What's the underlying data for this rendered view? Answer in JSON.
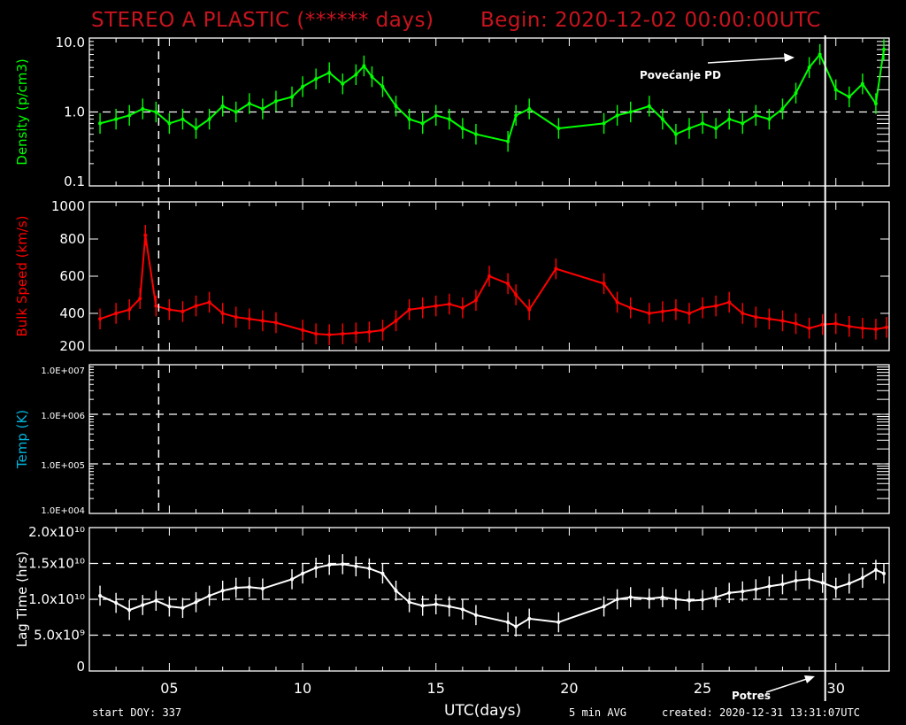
{
  "header": {
    "title": "STEREO A PLASTIC (****** days)",
    "begin": "Begin: 2020-12-02 00:00:00UTC"
  },
  "footer": {
    "start_doy": "start DOY: 337",
    "x_label": "UTC(days)",
    "avg": "5 min AVG",
    "created": "created: 2020-12-31 13:31:07UTC"
  },
  "annotations": {
    "density_increase": "Povećanje PD",
    "earthquake": "Potres"
  },
  "colors": {
    "background": "#000000",
    "title": "#c8141e",
    "density": "#00ff00",
    "speed": "#ff0000",
    "temp_label": "#00b4dc",
    "lag": "#ffffff",
    "axes": "#ffffff"
  },
  "chart_data": [
    {
      "type": "line",
      "name": "density-panel",
      "ylabel": "Density (p/cm3)",
      "yscale": "log",
      "ylim": [
        0.1,
        10.0
      ],
      "y_tick_labels": [
        "10.0",
        "1.0",
        "0.1"
      ],
      "reference_lines": [
        1.0
      ],
      "xlim": [
        2,
        32
      ],
      "x_tick_labels": [
        "05",
        "10",
        "15",
        "20",
        "25",
        "30"
      ],
      "x": [
        2.4,
        3.0,
        3.5,
        4.0,
        4.5,
        5.0,
        5.5,
        6.0,
        6.5,
        7.0,
        7.5,
        8.0,
        8.5,
        9.0,
        9.6,
        10.0,
        10.5,
        11.0,
        11.5,
        12.0,
        12.3,
        12.6,
        13.0,
        13.5,
        14.0,
        14.5,
        15.0,
        15.5,
        16.0,
        16.5,
        17.7,
        18.0,
        18.5,
        19.6,
        21.3,
        21.8,
        22.3,
        23.0,
        23.5,
        24.0,
        24.5,
        25.0,
        25.5,
        26.0,
        26.5,
        27.0,
        27.5,
        28.0,
        28.5,
        29.0,
        29.4,
        30.0,
        30.5,
        31.0,
        31.5,
        31.8
      ],
      "y": [
        0.7,
        0.8,
        0.9,
        1.1,
        1.0,
        0.7,
        0.8,
        0.6,
        0.8,
        1.2,
        1.0,
        1.3,
        1.1,
        1.4,
        1.6,
        2.2,
        2.8,
        3.4,
        2.4,
        3.2,
        4.2,
        3.0,
        2.2,
        1.2,
        0.8,
        0.7,
        0.9,
        0.8,
        0.6,
        0.5,
        0.4,
        0.9,
        1.1,
        0.6,
        0.7,
        0.9,
        1.0,
        1.2,
        0.8,
        0.5,
        0.6,
        0.7,
        0.6,
        0.8,
        0.7,
        0.9,
        0.8,
        1.1,
        1.8,
        4.0,
        6.0,
        2.0,
        1.6,
        2.4,
        1.3,
        7.0
      ]
    },
    {
      "type": "line",
      "name": "speed-panel",
      "ylabel": "Bulk Speed (km/s)",
      "ylim": [
        200,
        1000
      ],
      "y_tick_labels": [
        "1000",
        "800",
        "600",
        "400",
        "200"
      ],
      "xlim": [
        2,
        32
      ],
      "x": [
        2.4,
        3.0,
        3.5,
        3.9,
        4.1,
        4.5,
        5.0,
        5.5,
        6.0,
        6.5,
        7.0,
        7.5,
        8.0,
        8.5,
        9.0,
        10.0,
        10.5,
        11.0,
        11.5,
        12.0,
        12.5,
        13.0,
        13.5,
        14.0,
        14.5,
        15.0,
        15.5,
        16.0,
        16.5,
        17.0,
        17.7,
        18.0,
        18.5,
        19.5,
        21.3,
        21.8,
        22.3,
        23.0,
        23.5,
        24.0,
        24.5,
        25.0,
        25.5,
        26.0,
        26.5,
        27.0,
        27.5,
        28.0,
        28.5,
        29.0,
        29.5,
        30.0,
        30.5,
        31.0,
        31.5,
        31.9
      ],
      "y": [
        370,
        400,
        420,
        480,
        820,
        440,
        420,
        410,
        440,
        460,
        400,
        380,
        370,
        360,
        350,
        310,
        290,
        285,
        290,
        295,
        300,
        310,
        360,
        420,
        430,
        440,
        450,
        430,
        470,
        600,
        560,
        500,
        420,
        640,
        560,
        460,
        430,
        400,
        410,
        420,
        400,
        430,
        440,
        460,
        400,
        380,
        370,
        360,
        345,
        320,
        340,
        345,
        330,
        320,
        315,
        325
      ]
    },
    {
      "type": "line",
      "name": "temp-panel",
      "ylabel": "Temp (K)",
      "yscale": "log",
      "ylim": [
        10000,
        10000000
      ],
      "y_tick_labels": [
        "1.0E+007",
        "1.0E+006",
        "1.0E+005",
        "1.0E+004"
      ],
      "reference_lines": [
        1000000,
        100000
      ],
      "xlim": [
        2,
        32
      ],
      "x": [],
      "y": []
    },
    {
      "type": "line",
      "name": "lag-panel",
      "ylabel": "Lag Time (hrs)",
      "ylim": [
        0,
        20000000000
      ],
      "y_tick_labels": [
        "2.0x10¹⁰",
        "1.5x10¹⁰",
        "1.0x10¹⁰",
        "5.0x10⁹",
        "0"
      ],
      "reference_lines": [
        15000000000,
        10000000000,
        5000000000
      ],
      "xlim": [
        2,
        32
      ],
      "x": [
        2.4,
        3.0,
        3.5,
        4.0,
        4.5,
        5.0,
        5.5,
        6.0,
        6.5,
        7.0,
        7.5,
        8.0,
        8.5,
        9.6,
        10.0,
        10.5,
        11.0,
        11.5,
        12.0,
        12.5,
        13.0,
        13.5,
        14.0,
        14.5,
        15.0,
        15.5,
        16.0,
        16.5,
        17.7,
        18.0,
        18.5,
        19.6,
        21.3,
        21.8,
        22.3,
        23.0,
        23.5,
        24.0,
        24.5,
        25.0,
        25.5,
        26.0,
        26.5,
        27.0,
        27.5,
        28.0,
        28.5,
        29.0,
        29.5,
        30.0,
        30.5,
        31.0,
        31.5,
        31.8
      ],
      "y": [
        10500000000,
        9500000000,
        8500000000,
        9200000000,
        9800000000,
        9000000000,
        8800000000,
        9600000000,
        10500000000,
        11200000000,
        11600000000,
        11700000000,
        11500000000,
        12800000000,
        13600000000,
        14400000000,
        14800000000,
        14900000000,
        14600000000,
        14300000000,
        13600000000,
        11200000000,
        9600000000,
        9100000000,
        9300000000,
        9000000000,
        8600000000,
        7800000000,
        6800000000,
        6200000000,
        7300000000,
        6800000000,
        9000000000,
        10000000000,
        10300000000,
        10100000000,
        10300000000,
        10000000000,
        9800000000,
        9900000000,
        10300000000,
        10900000000,
        11100000000,
        11400000000,
        11800000000,
        12100000000,
        12600000000,
        12800000000,
        12300000000,
        11600000000,
        12200000000,
        13000000000,
        14100000000,
        13600000000
      ]
    }
  ],
  "markers": {
    "vertical_dashed_day": 4.6,
    "vertical_solid_day": 29.6
  }
}
